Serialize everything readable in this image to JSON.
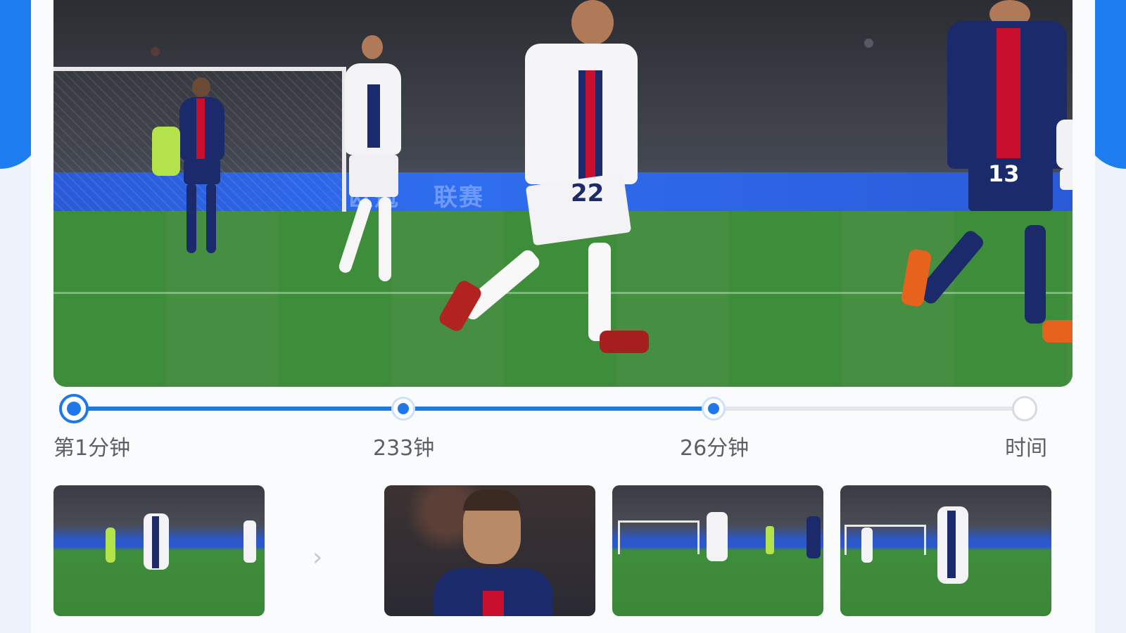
{
  "hero": {
    "board_text_1": "欧冠",
    "board_text_2": "联赛"
  },
  "timeline": {
    "progress_fraction": 0.67,
    "points": [
      {
        "label": "第1分钟",
        "state": "completed"
      },
      {
        "label": "233钟",
        "state": "completed"
      },
      {
        "label": "26分钟",
        "state": "current"
      },
      {
        "label": "时间",
        "state": "upcoming"
      }
    ]
  },
  "thumbnails": [
    {
      "type": "match-scene"
    },
    {
      "type": "player-portrait"
    },
    {
      "type": "match-scene"
    },
    {
      "type": "match-scene"
    }
  ],
  "colors": {
    "accent": "#1e78ea",
    "track_inactive": "#e3e6ec",
    "label_text": "#5a5f68"
  },
  "icons": {
    "scroll_next": "chevron-right-icon"
  }
}
